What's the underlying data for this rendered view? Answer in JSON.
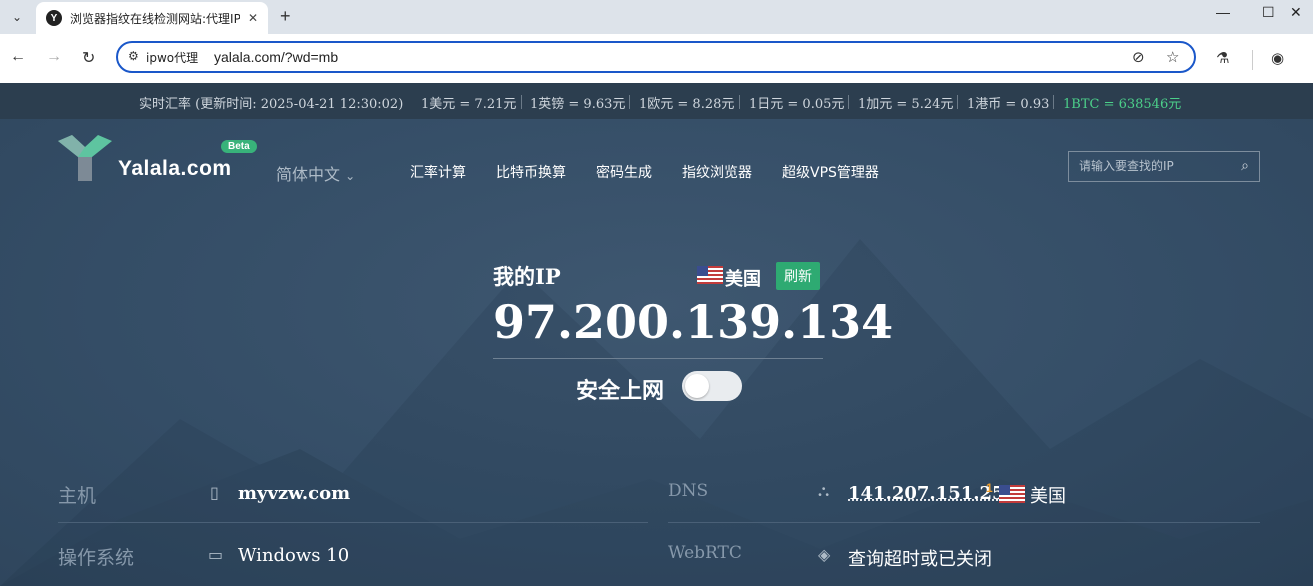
{
  "browser": {
    "tab_title": "浏览器指纹在线检测网站:代理IP检测",
    "favicon_letter": "Y",
    "address_chip": "ipwo代理",
    "url": "yalala.com/?wd=mb"
  },
  "rates": {
    "label": "实时汇率 (更新时间: 2025-04-21 12:30:02)",
    "items": [
      "1美元 = 7.21元",
      "1英镑 = 9.63元",
      "1欧元 = 8.28元",
      "1日元 = 0.05元",
      "1加元 = 5.24元",
      "1港币 = 0.93"
    ],
    "btc": "1BTC = 638546元",
    "btc_color": "#4cd08a"
  },
  "header": {
    "logo_text": "Yalala.com",
    "beta": "Beta",
    "language": "简体中文",
    "nav": [
      "汇率计算",
      "比特币换算",
      "密码生成",
      "指纹浏览器",
      "超级VPS管理器"
    ],
    "search_placeholder": "请输入要查找的IP"
  },
  "ip_card": {
    "label": "我的IP",
    "country": "美国",
    "refresh": "刷新",
    "ip": "97.200.139.134",
    "safe_label": "安全上网",
    "safe_on": false,
    "accent": "#2eaa72"
  },
  "info": {
    "host_label": "主机",
    "host_value": "myvzw.com",
    "os_label": "操作系统",
    "os_value": "Windows 10",
    "dns_label": "DNS",
    "dns_ip": "141.207.151.254",
    "dns_sup": "1",
    "dns_country": "美国",
    "webrtc_label": "WebRTC",
    "webrtc_value": "查询超时或已关闭"
  }
}
